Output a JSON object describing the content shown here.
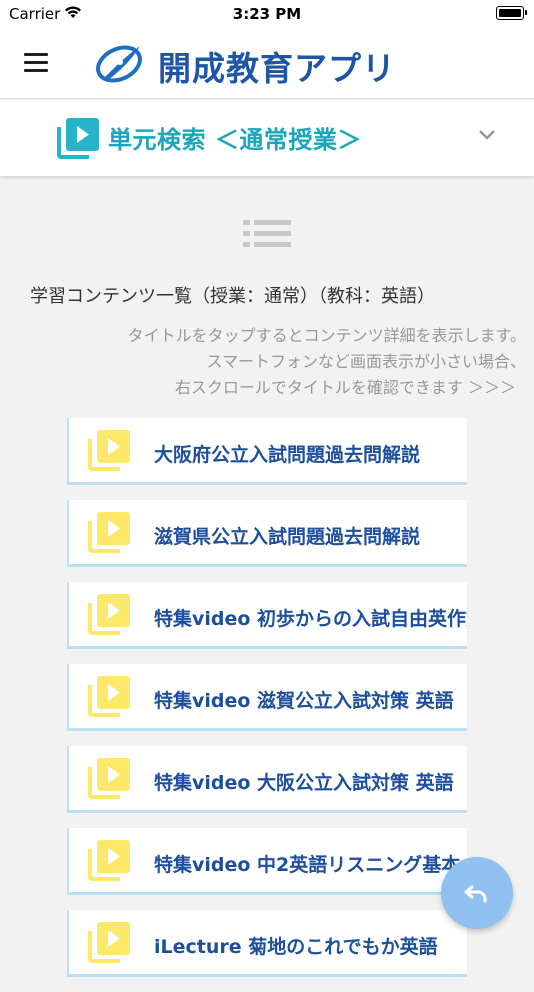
{
  "status_bar": {
    "carrier": "Carrier",
    "time": "3:23 PM"
  },
  "header": {
    "app_title": "開成教育アプリ"
  },
  "unit_search": {
    "title": "単元検索 ＜通常授業＞"
  },
  "content": {
    "heading": "学習コンテンツ一覧（授業：通常）（教科：英語）",
    "hints": [
      "タイトルをタップするとコンテンツ詳細を表示します。",
      "スマートフォンなど画面表示が小さい場合、",
      "右スクロールでタイトルを確認できます ＞＞＞"
    ],
    "items": [
      {
        "label": "大阪府公立入試問題過去問解説"
      },
      {
        "label": "滋賀県公立入試問題過去問解説"
      },
      {
        "label": "特集video 初歩からの入試自由英作文"
      },
      {
        "label": "特集video 滋賀公立入試対策 英語"
      },
      {
        "label": "特集video 大阪公立入試対策 英語"
      },
      {
        "label": "特集video 中2英語リスニング基本"
      },
      {
        "label": "iLecture 菊地のこれでもか英語"
      }
    ]
  },
  "colors": {
    "title_blue": "#1e55a5",
    "unit_teal": "#1aa6bd",
    "item_blue": "#1d4f9c",
    "video_icon_yellow": "#fde86a",
    "fab_blue": "#8ec1f0"
  }
}
